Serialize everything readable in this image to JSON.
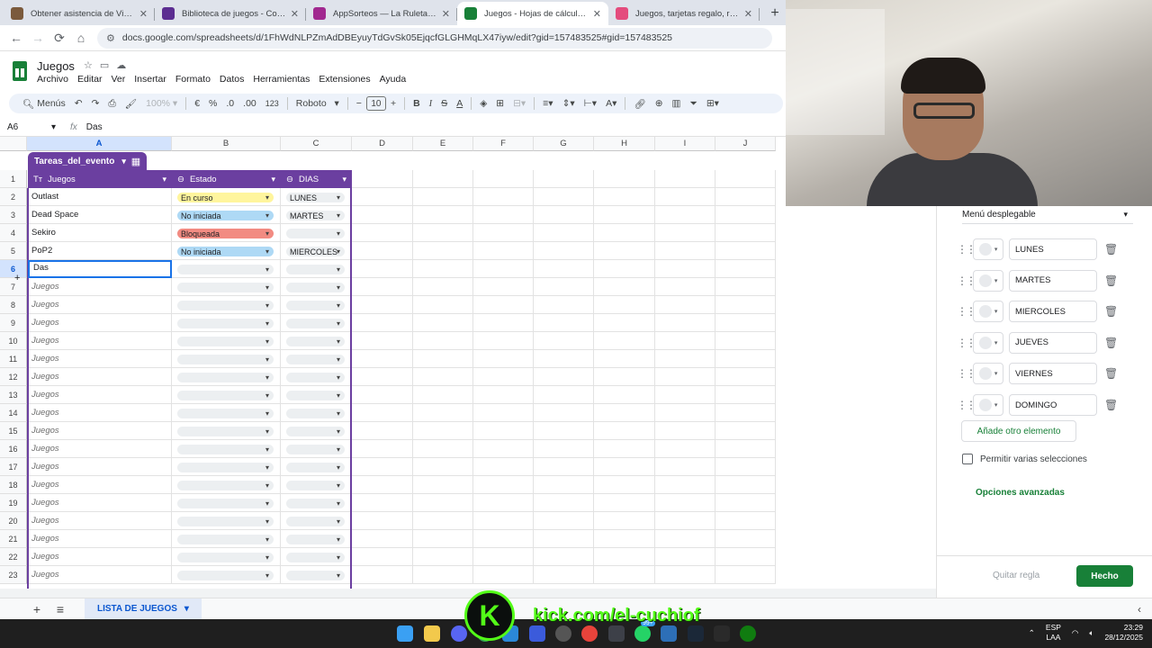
{
  "browser": {
    "tabs": [
      {
        "title": "Obtener asistencia de Vincular",
        "color": "#7b5a3c",
        "active": false
      },
      {
        "title": "Biblioteca de juegos - Compra",
        "color": "#5c2d91",
        "active": false
      },
      {
        "title": "AppSorteos — La Ruleta de",
        "color": "#a1288f",
        "active": false
      },
      {
        "title": "Juegos - Hojas de cálculo de G",
        "color": "#188038",
        "active": true
      },
      {
        "title": "Juegos, tarjetas regalo, recarga",
        "color": "#e44c7d",
        "active": false
      }
    ],
    "url": "docs.google.com/spreadsheets/d/1FhWdNLPZmAdDBEyuyTdGvSk05EjqcfGLGHMqLX47iyw/edit?gid=157483525#gid=157483525"
  },
  "doc": {
    "title": "Juegos",
    "menu": [
      "Archivo",
      "Editar",
      "Ver",
      "Insertar",
      "Formato",
      "Datos",
      "Herramientas",
      "Extensiones",
      "Ayuda"
    ]
  },
  "toolbar": {
    "menus": "Menús",
    "zoom": "100%",
    "currency": "€",
    "percent": "%",
    "dec_less": ".0",
    "dec_more": ".00",
    "number_fmt": "123",
    "font": "Roboto",
    "font_size": "10"
  },
  "formula": {
    "cell_ref": "A6",
    "value": "Das"
  },
  "grid": {
    "columns": [
      "A",
      "B",
      "C",
      "D",
      "E",
      "F",
      "G",
      "H",
      "I",
      "J"
    ],
    "table_name": "Tareas_del_evento",
    "headers": {
      "a": "Juegos",
      "b": "Estado",
      "c": "DIAS"
    },
    "rows": [
      {
        "n": "1"
      },
      {
        "n": "2",
        "a": "Outlast",
        "b": "En curso",
        "b_color": "#fff59d",
        "c": "LUNES"
      },
      {
        "n": "3",
        "a": "Dead Space",
        "b": "No iniciada",
        "b_color": "#aed9f5",
        "c": "MARTES"
      },
      {
        "n": "4",
        "a": "Sekiro",
        "b": "Bloqueada",
        "b_color": "#f28b82",
        "c": ""
      },
      {
        "n": "5",
        "a": "PoP2",
        "b": "No iniciada",
        "b_color": "#aed9f5",
        "c": "MIERCOLES"
      },
      {
        "n": "6",
        "a": "Das",
        "b": "",
        "c": ""
      },
      {
        "n": "7",
        "a": "Juegos"
      },
      {
        "n": "8",
        "a": "Juegos"
      },
      {
        "n": "9",
        "a": "Juegos"
      },
      {
        "n": "10",
        "a": "Juegos"
      },
      {
        "n": "11",
        "a": "Juegos"
      },
      {
        "n": "12",
        "a": "Juegos"
      },
      {
        "n": "13",
        "a": "Juegos"
      },
      {
        "n": "14",
        "a": "Juegos"
      },
      {
        "n": "15",
        "a": "Juegos"
      },
      {
        "n": "16",
        "a": "Juegos"
      },
      {
        "n": "17",
        "a": "Juegos"
      },
      {
        "n": "18",
        "a": "Juegos"
      },
      {
        "n": "19",
        "a": "Juegos"
      },
      {
        "n": "20",
        "a": "Juegos"
      },
      {
        "n": "21",
        "a": "Juegos"
      },
      {
        "n": "22",
        "a": "Juegos"
      },
      {
        "n": "23",
        "a": "Juegos"
      }
    ]
  },
  "sheet_tab": "LISTA DE JUEGOS",
  "panel": {
    "criteria": "Menú desplegable",
    "options": [
      "LUNES",
      "MARTES",
      "MIERCOLES",
      "JUEVES",
      "VIERNES",
      "DOMINGO"
    ],
    "add_item": "Añade otro elemento",
    "multi_select": "Permitir varias selecciones",
    "advanced": "Opciones avanzadas",
    "remove": "Quitar regla",
    "done": "Hecho"
  },
  "overlay": {
    "kick_text": "kick.com/el-cuchiof",
    "kick_logo": "K"
  },
  "taskbar": {
    "lang1": "ESP",
    "lang2": "LAA",
    "time": "23:29",
    "date": "28/12/2025",
    "badge": "99+"
  }
}
